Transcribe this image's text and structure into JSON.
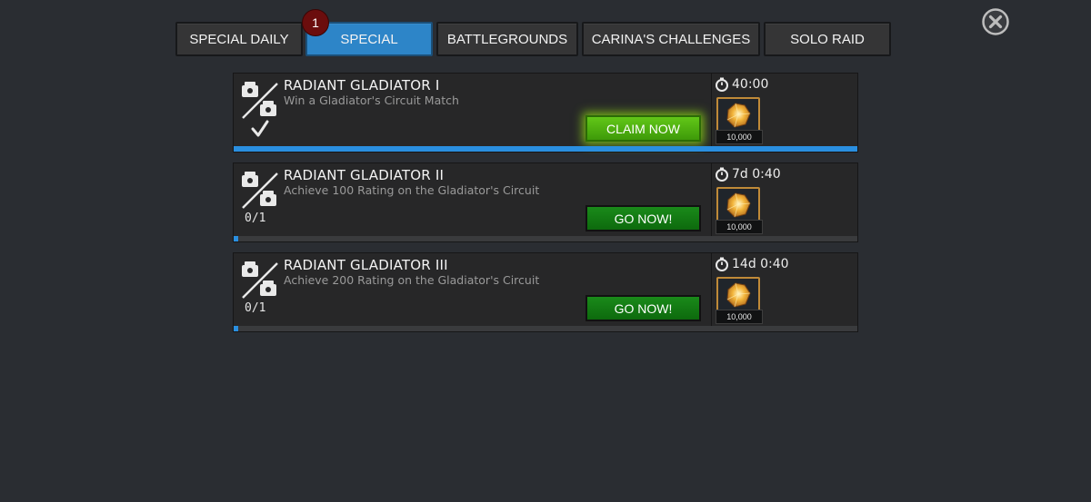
{
  "tabs": [
    {
      "label": "SPECIAL DAILY",
      "active": false
    },
    {
      "label": "SPECIAL",
      "active": true,
      "badge": "1"
    },
    {
      "label": "BATTLEGROUNDS",
      "active": false
    },
    {
      "label": "CARINA'S CHALLENGES",
      "active": false
    },
    {
      "label": "SOLO RAID",
      "active": false
    }
  ],
  "close_icon": "close-icon",
  "quests": [
    {
      "title": "RADIANT GLADIATOR I",
      "description": "Win a Gladiator's Circuit Match",
      "count": "",
      "completed": true,
      "action_label": "CLAIM NOW",
      "action_kind": "claim",
      "timer": "40:00",
      "reward_amount": "10,000",
      "progress": 1.0
    },
    {
      "title": "RADIANT GLADIATOR II",
      "description": "Achieve 100 Rating on the Gladiator's Circuit",
      "count": "0/1",
      "completed": false,
      "action_label": "GO NOW!",
      "action_kind": "go",
      "timer": "7d 0:40",
      "reward_amount": "10,000",
      "progress": 0.0
    },
    {
      "title": "RADIANT GLADIATOR III",
      "description": "Achieve 200 Rating on the Gladiator's Circuit",
      "count": "0/1",
      "completed": false,
      "action_label": "GO NOW!",
      "action_kind": "go",
      "timer": "14d 0:40",
      "reward_amount": "10,000",
      "progress": 0.0
    }
  ],
  "colors": {
    "background": "#2a2d32",
    "tab_active": "#2d85c8",
    "progress": "#2a8fe0",
    "claim_button": "#4fb411",
    "go_button": "#127a12",
    "badge": "#6b0d0d"
  }
}
